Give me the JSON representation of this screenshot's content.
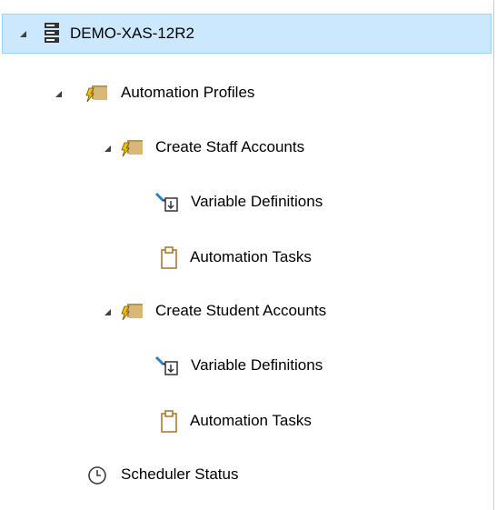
{
  "tree": {
    "nodes": [
      {
        "label": "DEMO-XAS-12R2",
        "icon": "server-icon",
        "expanded": true,
        "selected": true
      },
      {
        "label": "Automation Profiles",
        "icon": "folder-lightning-icon",
        "expanded": true
      },
      {
        "label": "Create Staff Accounts",
        "icon": "folder-lightning-icon",
        "expanded": true
      },
      {
        "label": "Variable Definitions",
        "icon": "variable-definitions-icon"
      },
      {
        "label": "Automation Tasks",
        "icon": "clipboard-icon"
      },
      {
        "label": "Create Student Accounts",
        "icon": "folder-lightning-icon",
        "expanded": true
      },
      {
        "label": "Variable Definitions",
        "icon": "variable-definitions-icon"
      },
      {
        "label": "Automation Tasks",
        "icon": "clipboard-icon"
      },
      {
        "label": "Scheduler Status",
        "icon": "clock-icon"
      }
    ]
  },
  "colors": {
    "selection_background": "#cce8ff",
    "selection_border": "#99d1ff",
    "folder_tan": "#d8b779",
    "folder_shadow": "#b8955a",
    "lightning_gold": "#f2c200",
    "clipboard_outline": "#b07a2e",
    "clock_stroke": "#404040",
    "server_dark": "#333333"
  }
}
